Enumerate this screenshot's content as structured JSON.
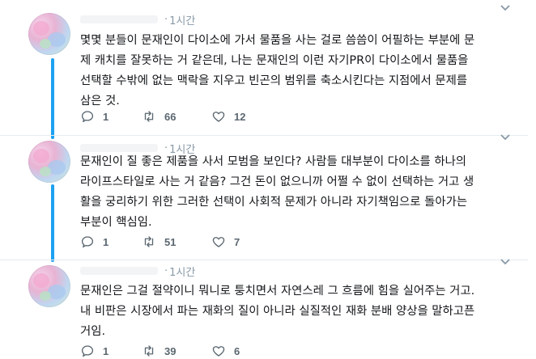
{
  "tweets": [
    {
      "time": "1시간",
      "text": "몇몇 분들이 문재인이 다이소에 가서 물품을 사는 걸로 씀씀이 어필하는 부분에 문\n제 캐치를 잘못하는 거 같은데, 나는 문재인의 이런 자기PR이 다이소에서 물품을\n선택할 수밖에 없는 맥락을 지우고 빈곤의 범위를 축소시킨다는 지점에서 문제를\n삼은 것.",
      "replies": "1",
      "retweets": "66",
      "likes": "12"
    },
    {
      "time": "1시간",
      "text": "문재인이 질 좋은 제품을 사서 모범을 보인다? 사람들 대부분이 다이소를 하나의\n라이프스타일로 사는 거 같음? 그건 돈이 없으니까 어쩔 수 없이 선택하는 거고 생\n활을 궁리하기 위한 그러한 선택이 사회적 문제가 아니라 자기책임으로 돌아가는\n부분이 핵심임.",
      "replies": "1",
      "retweets": "51",
      "likes": "7"
    },
    {
      "time": "1시간",
      "text": "문재인은 그걸 절약이니 뭐니로 퉁치면서 자연스레 그 흐름에 힘을 실어주는 거고.\n내 비판은 시장에서 파는 재화의 질이 아니라 실질적인 재화 분배 양상을 말하고픈\n거임.",
      "replies": "1",
      "retweets": "39",
      "likes": "6"
    }
  ],
  "meta": {
    "time_prefix": "·"
  },
  "icons": {
    "reply": "reply-icon",
    "retweet": "retweet-icon",
    "like": "heart-icon",
    "caret": "chevron-down-icon"
  },
  "colors": {
    "thread_line": "#1da1f2",
    "muted_text": "#8899a6",
    "action_gray": "#5b6770",
    "divider": "#e6ecf0"
  }
}
